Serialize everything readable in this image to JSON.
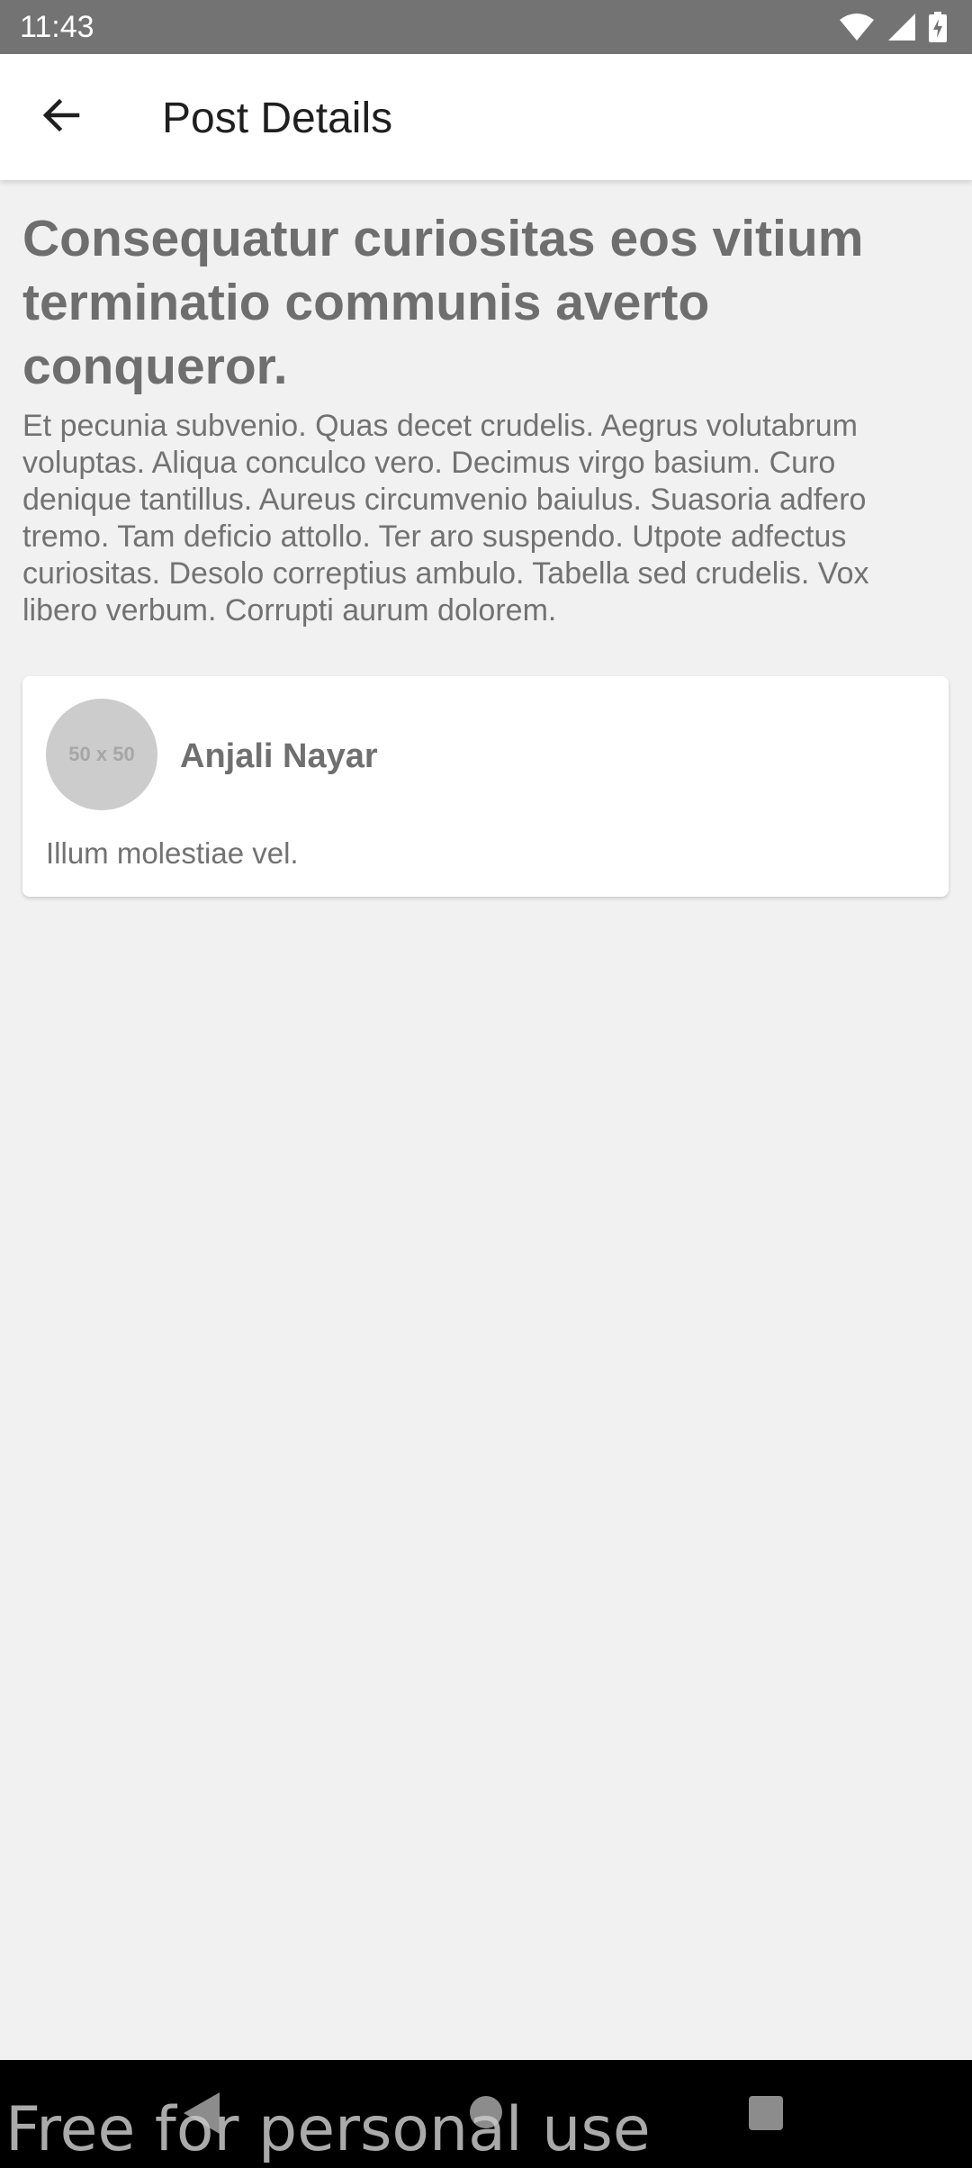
{
  "status_bar": {
    "time": "11:43",
    "icons": [
      "wifi-icon",
      "signal-icon",
      "battery-charging-icon"
    ]
  },
  "app_bar": {
    "back_icon": "arrow-left-icon",
    "title": "Post Details"
  },
  "post": {
    "title": "Consequatur curiositas eos vitium terminatio communis averto conqueror.",
    "body": "Et pecunia subvenio. Quas decet crudelis. Aegrus volutabrum voluptas. Aliqua conculco vero. Decimus virgo basium. Curo denique tantillus. Aureus circumvenio baiulus. Suasoria adfero tremo. Tam deficio attollo. Ter aro suspendo. Utpote adfectus curiositas. Desolo correptius ambulo. Tabella sed crudelis. Vox libero verbum. Corrupti aurum dolorem."
  },
  "comments": [
    {
      "avatar_placeholder": "50 x 50",
      "author": "Anjali Nayar",
      "text": "Illum molestiae vel."
    }
  ],
  "nav_bar": {
    "icons": [
      "nav-back-icon",
      "nav-home-icon",
      "nav-recents-icon"
    ],
    "watermark": "Free for personal use"
  },
  "colors": {
    "status_bar": "#737373",
    "app_bar": "#ffffff",
    "page_background": "#f1f1f1",
    "title_text": "#6e6e6e",
    "body_text": "#727272",
    "avatar": "#cccccc",
    "nav_bar": "#000000"
  }
}
